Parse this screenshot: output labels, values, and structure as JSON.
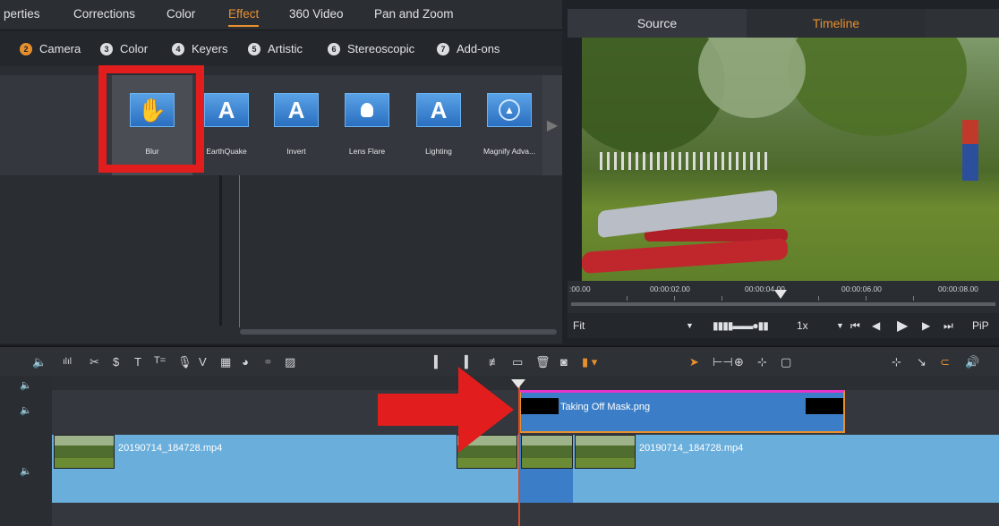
{
  "top_tabs": [
    "perties",
    "Corrections",
    "Color",
    "Effect",
    "360 Video",
    "Pan and Zoom"
  ],
  "sub_tabs": [
    {
      "num": "2",
      "label": "Camera"
    },
    {
      "num": "3",
      "label": "Color"
    },
    {
      "num": "4",
      "label": "Keyers"
    },
    {
      "num": "5",
      "label": "Artistic"
    },
    {
      "num": "6",
      "label": "Stereoscopic"
    },
    {
      "num": "7",
      "label": "Add-ons"
    }
  ],
  "effects": [
    "Blur",
    "EarthQuake",
    "Invert",
    "Lens Flare",
    "Lighting",
    "Magnify Adva..."
  ],
  "preview": {
    "source_tab": "Source",
    "timeline_tab": "Timeline",
    "ruler_labels": [
      ":00.00",
      "00:00:02.00",
      "00:00:04.00",
      "00:00:06.00",
      "00:00:08.00"
    ],
    "fit_label": "Fit",
    "speed": "1x",
    "pip": "PiP"
  },
  "timeline": {
    "overlay_clip": "Taking Off Mask.png",
    "video_clip_a": "20190714_184728.mp4",
    "video_clip_b": "20190714_184728.mp4"
  },
  "colors": {
    "accent": "#e8902e",
    "annotation_red": "#e11d1d",
    "clip_blue": "#3b7ec7",
    "track_blue": "#6aaedb"
  }
}
